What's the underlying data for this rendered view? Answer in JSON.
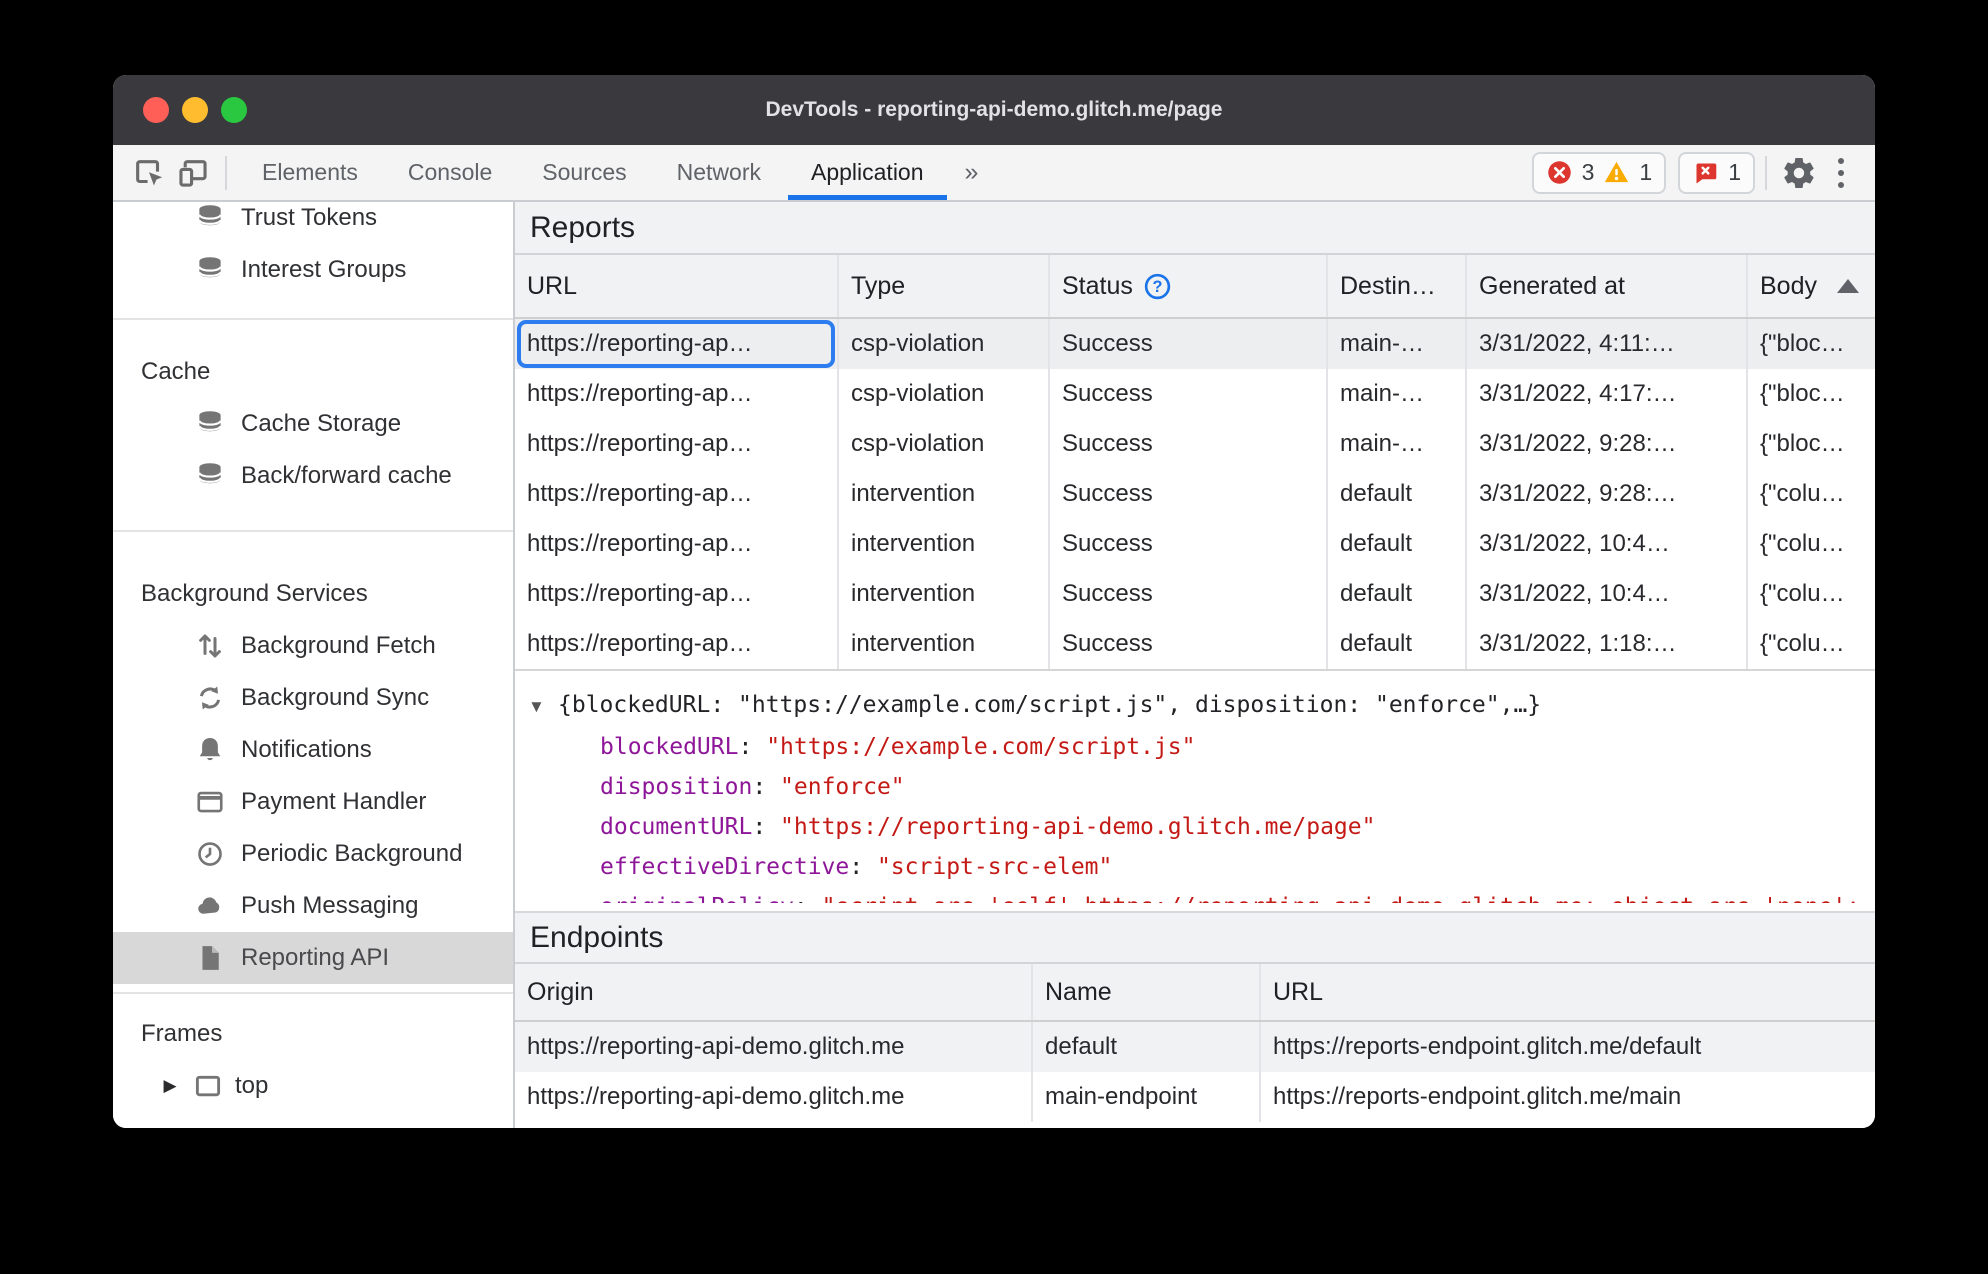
{
  "window": {
    "title": "DevTools - reporting-api-demo.glitch.me/page"
  },
  "toolbar": {
    "tabs": [
      "Elements",
      "Console",
      "Sources",
      "Network",
      "Application"
    ],
    "selected_tab": "Application",
    "more_symbol": "»",
    "badges": {
      "errors": "3",
      "warnings": "1",
      "issues": "1"
    }
  },
  "colors": {
    "accent_blue": "#1a73e8",
    "error_red": "#dc362e",
    "warning_yellow": "#f9ab00",
    "issue_red": "#dc362e",
    "json_key_purple": "#8e1699",
    "json_string_red": "#c41a16",
    "selected_sidebar_gray": "#d8d8d8",
    "selected_row_gray": "#eceef0",
    "focus_outline_blue": "#2e7df0"
  },
  "sidebar": {
    "sections": [
      {
        "items": [
          {
            "icon": "database-icon",
            "label": "Trust Tokens"
          },
          {
            "icon": "database-icon",
            "label": "Interest Groups"
          }
        ]
      },
      {
        "header": "Cache",
        "items": [
          {
            "icon": "database-icon",
            "label": "Cache Storage"
          },
          {
            "icon": "database-icon",
            "label": "Back/forward cache"
          }
        ]
      },
      {
        "header": "Background Services",
        "items": [
          {
            "icon": "background-fetch-icon",
            "label": "Background Fetch"
          },
          {
            "icon": "background-sync-icon",
            "label": "Background Sync"
          },
          {
            "icon": "notifications-bell-icon",
            "label": "Notifications"
          },
          {
            "icon": "payment-card-icon",
            "label": "Payment Handler"
          },
          {
            "icon": "clock-icon",
            "label": "Periodic Background"
          },
          {
            "icon": "cloud-icon",
            "label": "Push Messaging"
          },
          {
            "icon": "document-icon",
            "label": "Reporting API",
            "selected": true
          }
        ]
      },
      {
        "header": "Frames",
        "items": [
          {
            "icon": "frame-icon",
            "label": "top",
            "expandable": true
          }
        ]
      }
    ],
    "disclosure_collapsed": "▶"
  },
  "reports": {
    "heading": "Reports",
    "columns": {
      "url": "URL",
      "type": "Type",
      "status": "Status",
      "destination": "Destin…",
      "generated": "Generated at",
      "body": "Body"
    },
    "sort": {
      "column": "Body",
      "direction": "ascending"
    },
    "rows": [
      {
        "url": "https://reporting-ap…",
        "type": "csp-violation",
        "status": "Success",
        "destination": "main-…",
        "generated": "3/31/2022, 4:11:…",
        "body": "{\"bloc…"
      },
      {
        "url": "https://reporting-ap…",
        "type": "csp-violation",
        "status": "Success",
        "destination": "main-…",
        "generated": "3/31/2022, 4:17:…",
        "body": "{\"bloc…"
      },
      {
        "url": "https://reporting-ap…",
        "type": "csp-violation",
        "status": "Success",
        "destination": "main-…",
        "generated": "3/31/2022, 9:28:…",
        "body": "{\"bloc…"
      },
      {
        "url": "https://reporting-ap…",
        "type": "intervention",
        "status": "Success",
        "destination": "default",
        "generated": "3/31/2022, 9:28:…",
        "body": "{\"colu…"
      },
      {
        "url": "https://reporting-ap…",
        "type": "intervention",
        "status": "Success",
        "destination": "default",
        "generated": "3/31/2022, 10:4…",
        "body": "{\"colu…"
      },
      {
        "url": "https://reporting-ap…",
        "type": "intervention",
        "status": "Success",
        "destination": "default",
        "generated": "3/31/2022, 10:4…",
        "body": "{\"colu…"
      },
      {
        "url": "https://reporting-ap…",
        "type": "intervention",
        "status": "Success",
        "destination": "default",
        "generated": "3/31/2022, 1:18:…",
        "body": "{\"colu…"
      }
    ]
  },
  "detail": {
    "disclosure_expanded": "▼",
    "preview": "{blockedURL: \"https://example.com/script.js\", disposition: \"enforce\",…}",
    "properties": [
      {
        "key": "blockedURL",
        "sep": ": ",
        "value": "\"https://example.com/script.js\""
      },
      {
        "key": "disposition",
        "sep": ": ",
        "value": "\"enforce\""
      },
      {
        "key": "documentURL",
        "sep": ": ",
        "value": "\"https://reporting-api-demo.glitch.me/page\""
      },
      {
        "key": "effectiveDirective",
        "sep": ": ",
        "value": "\"script-src-elem\""
      },
      {
        "key": "originalPolicy",
        "sep": ": ",
        "value": "\"script-src 'self' https://reporting-api-demo.glitch.me; object-src 'none'; report-to main-endpoint;\""
      }
    ]
  },
  "endpoints": {
    "heading": "Endpoints",
    "columns": {
      "origin": "Origin",
      "name": "Name",
      "url": "URL"
    },
    "rows": [
      {
        "origin": "https://reporting-api-demo.glitch.me",
        "name": "default",
        "url": "https://reports-endpoint.glitch.me/default"
      },
      {
        "origin": "https://reporting-api-demo.glitch.me",
        "name": "main-endpoint",
        "url": "https://reports-endpoint.glitch.me/main"
      }
    ]
  }
}
